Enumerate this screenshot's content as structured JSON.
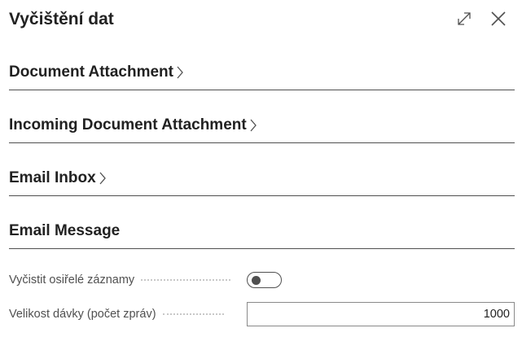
{
  "dialog": {
    "title": "Vyčištění dat",
    "icons": [
      "expand-icon",
      "close-icon"
    ]
  },
  "sections": [
    {
      "label": "Document Attachment",
      "collapsed": true
    },
    {
      "label": "Incoming Document Attachment",
      "collapsed": true
    },
    {
      "label": "Email Inbox",
      "collapsed": true
    },
    {
      "label": "Email Message",
      "collapsed": false
    }
  ],
  "fields": {
    "orphans": {
      "label": "Vyčistit osiřelé záznamy",
      "value": false
    },
    "batch_size": {
      "label": "Velikost dávky (počet zpráv)",
      "value": "1000"
    }
  }
}
